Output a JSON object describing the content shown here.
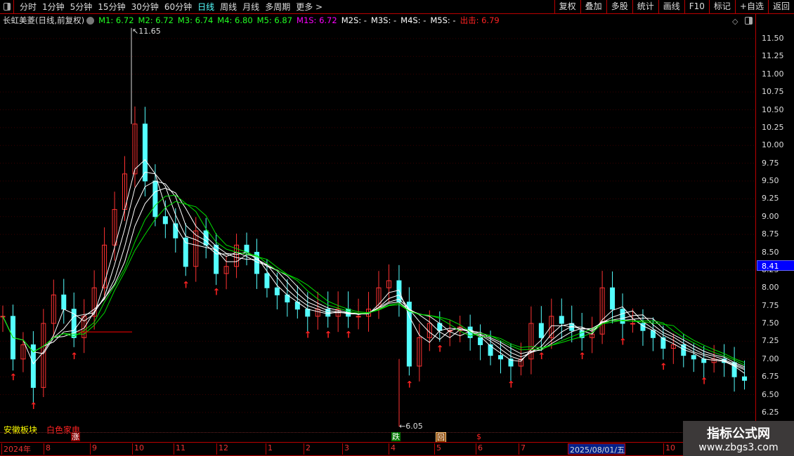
{
  "toolbar": {
    "periods": [
      "分时",
      "1分钟",
      "5分钟",
      "15分钟",
      "30分钟",
      "60分钟",
      "日线",
      "周线",
      "月线",
      "多周期",
      "更多 >"
    ],
    "active": "日线",
    "actions": [
      "复权",
      "叠加",
      "多股",
      "统计",
      "画线",
      "F10",
      "标记",
      "+自选",
      "返回"
    ]
  },
  "info": {
    "title": "长虹美菱(日线,前复权)",
    "m1": "M1: 6.72",
    "m2": "M2: 6.72",
    "m3": "M3: 6.74",
    "m4": "M4: 6.80",
    "m5": "M5: 6.87",
    "m1s": "M1S: 6.72",
    "m2s": "M2S: -",
    "m3s": "M3S: -",
    "m4s": "M4S: -",
    "m5s": "M5S: -",
    "chuji": "出击: 6.79"
  },
  "colors": {
    "up": "#ff3232",
    "down": "#54ffff",
    "ma": "#ffffff",
    "ma2": "#00e000",
    "signal": "#ff0000"
  },
  "price_axis": {
    "ticks": [
      "11.50",
      "11.25",
      "11.00",
      "10.75",
      "10.50",
      "10.25",
      "10.00",
      "9.75",
      "9.50",
      "9.25",
      "9.00",
      "8.75",
      "8.50",
      "8.25",
      "8.00",
      "7.75",
      "7.50",
      "7.25",
      "7.00",
      "6.75",
      "6.50",
      "6.25"
    ],
    "current": "8.41"
  },
  "annotations": {
    "high": "11.65",
    "low": "6.05"
  },
  "sector": {
    "region": "安徽板块",
    "industry": "白色家电"
  },
  "markers": {
    "zhang": "涨",
    "die": "跌",
    "hui": "回",
    "dollar": "$"
  },
  "xaxis": {
    "labels": [
      "2024年",
      "8",
      "9",
      "10",
      "11",
      "12",
      "1",
      "2",
      "3",
      "4",
      "5",
      "6",
      "7",
      "2025/08/01/五",
      "10"
    ]
  },
  "watermark": {
    "name": "指标公式网",
    "url": "www.zbgs3.com"
  },
  "chart_data": {
    "type": "candlestick",
    "ylim": [
      6.05,
      11.65
    ],
    "closes": [
      7.6,
      7.0,
      7.2,
      6.6,
      7.5,
      7.9,
      7.7,
      7.3,
      7.6,
      8.0,
      8.6,
      9.1,
      9.6,
      10.3,
      9.5,
      9.0,
      8.9,
      8.7,
      8.3,
      8.8,
      8.6,
      8.2,
      8.3,
      8.6,
      8.5,
      8.2,
      8.0,
      7.9,
      7.8,
      7.7,
      7.6,
      7.7,
      7.6,
      7.7,
      7.6,
      7.6,
      7.7,
      8.0,
      8.1,
      7.8,
      6.9,
      7.3,
      7.5,
      7.4,
      7.4,
      7.45,
      7.3,
      7.2,
      7.05,
      7.0,
      6.9,
      7.0,
      7.5,
      7.3,
      7.6,
      7.5,
      7.4,
      7.3,
      7.35,
      8.0,
      7.7,
      7.5,
      7.5,
      7.4,
      7.3,
      7.15,
      7.2,
      7.05,
      7.0,
      6.95,
      7.0,
      6.95,
      6.75,
      6.7
    ]
  }
}
